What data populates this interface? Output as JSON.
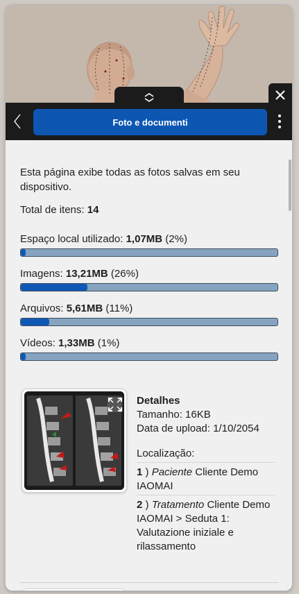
{
  "header": {
    "title": "Foto e documenti"
  },
  "intro_text": "Esta página exibe todas as fotos salvas em seu dispositivo.",
  "total": {
    "label": "Total de itens:",
    "value": "14"
  },
  "stats": [
    {
      "label": "Espaço local utilizado:",
      "value": "1,07MB",
      "percent_text": "(2%)",
      "percent": 2
    },
    {
      "label": "Imagens:",
      "value": "13,21MB",
      "percent_text": "(26%)",
      "percent": 26
    },
    {
      "label": "Arquivos:",
      "value": "5,61MB",
      "percent_text": "(11%)",
      "percent": 11
    },
    {
      "label": "Vídeos:",
      "value": "1,33MB",
      "percent_text": "(1%)",
      "percent": 1
    }
  ],
  "item": {
    "heading": "Detalhes",
    "size_label": "Tamanho:",
    "size_value": "16KB",
    "upload_label": "Data de upload:",
    "upload_value": "1/10/2054",
    "location_label": "Localização:",
    "locations": [
      {
        "num": "1",
        "type": "Paciente",
        "text": "Cliente Demo IAOMAI"
      },
      {
        "num": "2",
        "type": "Tratamento",
        "text": "Cliente Demo IAOMAI > Seduta 1: Valutazione iniziale e rilassamento"
      }
    ]
  },
  "colors": {
    "accent": "#0d57b3",
    "bar_fill": "#1058b5",
    "bar_track": "#86a4c0",
    "dark_bar": "#1b1b1b"
  },
  "icons": {
    "back": "chevron-left-icon",
    "close": "close-icon",
    "menu": "kebab-menu-icon",
    "collapse": "chevron-up-down-icon",
    "expand": "expand-icon"
  }
}
